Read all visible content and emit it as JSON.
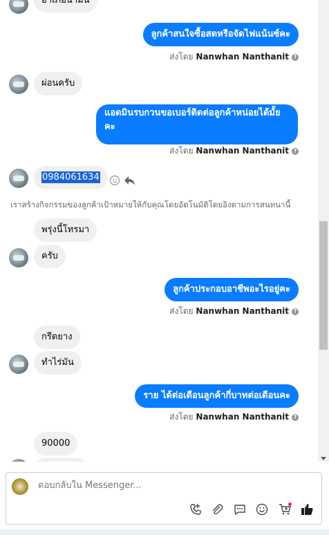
{
  "messages": {
    "m0_in": "อำเภอนามน",
    "m1_out": "ลูกค้าสนใจซื้อสดหรือจัดไฟแน้นซ์คะ",
    "m2_in": "ผ่อนครับ",
    "m3_out_line1": "แอดมินรบกวนขอเบอร์ติดต่อลูกค้าหน่อยได้มั้ย",
    "m3_out_line2": "คะ",
    "m4_in_phone": "0984061634",
    "system_note": "เราสร้างกิจกรรมของลูกค้าเป้าหมายให้กับคุณโดยอัตโนมัติโดยอิงตามการสนทนานี้",
    "m5_in": "พรุ่งนี้โทรมา",
    "m6_in": "ครับ",
    "m7_out": "ลูกค้าประกอบอาชีพอะไรอยู่คะ",
    "m8_in": "กรีดยาง",
    "m9_in": "ทำไร่มัน",
    "m10_out": "ราย ได้ต่อเดือนลูกค้ากี่บาทต่อเดือนคะ",
    "m11_in": "90000"
  },
  "sent_by": {
    "prefix": "ส่งโดย",
    "name": "Nanwhan Nanthanit",
    "help": "?"
  },
  "composer": {
    "placeholder": "ตอบกลับใน Messenger..."
  },
  "icons": {
    "tools": [
      "add-call-icon",
      "attachment-icon",
      "chat-bubble-icon",
      "emoji-icon",
      "add-to-cart-icon",
      "thumbs-up-icon"
    ],
    "accent": "#0a7cff"
  }
}
